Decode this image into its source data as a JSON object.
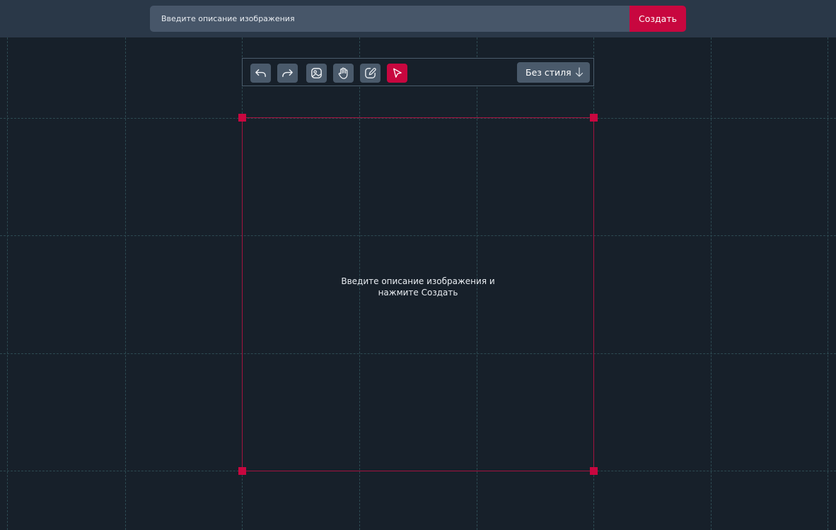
{
  "header": {
    "prompt_placeholder": "Введите описание изображения",
    "prompt_value": "",
    "create_label": "Создать"
  },
  "toolbar": {
    "tools": [
      {
        "name": "undo",
        "icon": "undo-icon",
        "active": false
      },
      {
        "name": "redo",
        "icon": "redo-icon",
        "active": false
      },
      {
        "name": "image",
        "icon": "image-icon",
        "active": false
      },
      {
        "name": "hand",
        "icon": "hand-icon",
        "active": false
      },
      {
        "name": "edit",
        "icon": "pencil-icon",
        "active": false
      },
      {
        "name": "select",
        "icon": "cursor-icon",
        "active": true
      }
    ],
    "style_label": "Без стиля",
    "style_arrow_icon": "arrow-down-icon"
  },
  "canvas": {
    "hint_line1": "Введите описание изображения и",
    "hint_line2": "нажмите Создать"
  },
  "colors": {
    "background": "#17202a",
    "header": "#2a3848",
    "accent": "#c8073f",
    "button": "#4a5a6b",
    "grid": "#2d4a52"
  }
}
